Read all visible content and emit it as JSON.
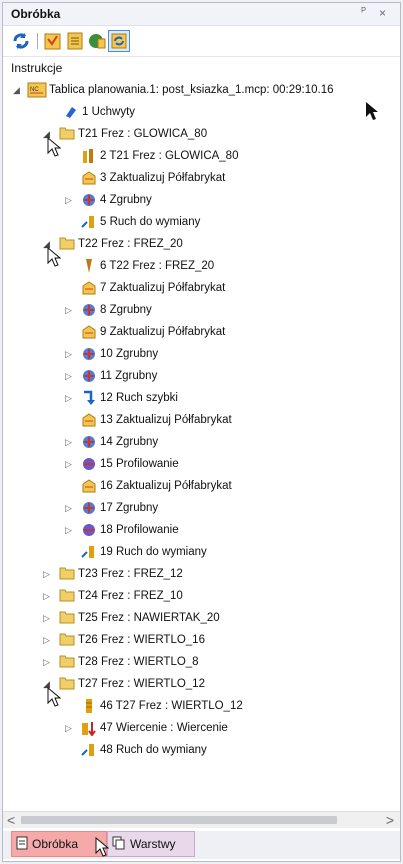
{
  "panel": {
    "title": "Obróbka",
    "pin_glyph": "ᴾ",
    "close_glyph": "×"
  },
  "toolbar": {
    "icons": [
      "refresh-icon",
      "operations-icon",
      "document-icon",
      "globe-tool-icon",
      "layers-refresh-icon"
    ]
  },
  "section_header": "Instrukcje",
  "tree": {
    "root": "Tablica planowania.1: post_ksiazka_1.mcp: 00:29:10.16",
    "items": [
      {
        "label": "1 Uchwyty"
      },
      {
        "label": "T21 Frez : GLOWICA_80"
      },
      {
        "label": "2 T21 Frez : GLOWICA_80"
      },
      {
        "label": "3 Zaktualizuj Półfabrykat"
      },
      {
        "label": "4 Zgrubny"
      },
      {
        "label": "5 Ruch do wymiany"
      },
      {
        "label": "T22 Frez : FREZ_20"
      },
      {
        "label": "6 T22 Frez : FREZ_20"
      },
      {
        "label": "7 Zaktualizuj Półfabrykat"
      },
      {
        "label": "8 Zgrubny"
      },
      {
        "label": "9 Zaktualizuj Półfabrykat"
      },
      {
        "label": "10 Zgrubny"
      },
      {
        "label": "11 Zgrubny"
      },
      {
        "label": "12 Ruch szybki"
      },
      {
        "label": "13 Zaktualizuj Półfabrykat"
      },
      {
        "label": "14 Zgrubny"
      },
      {
        "label": "15 Profilowanie"
      },
      {
        "label": "16 Zaktualizuj Półfabrykat"
      },
      {
        "label": "17 Zgrubny"
      },
      {
        "label": "18 Profilowanie"
      },
      {
        "label": "19 Ruch do wymiany"
      },
      {
        "label": "T23 Frez : FREZ_12"
      },
      {
        "label": "T24 Frez : FREZ_10"
      },
      {
        "label": "T25 Frez : NAWIERTAK_20"
      },
      {
        "label": "T26 Frez : WIERTLO_16"
      },
      {
        "label": "T28 Frez : WIERTLO_8"
      },
      {
        "label": "T27 Frez : WIERTLO_12"
      },
      {
        "label": "46 T27 Frez : WIERTLO_12"
      },
      {
        "label": "47 Wiercenie : Wiercenie"
      },
      {
        "label": "48 Ruch do wymiany"
      }
    ]
  },
  "scrollbar": {
    "left": "<",
    "right": ">"
  },
  "tabs": [
    {
      "label": "Obróbka",
      "active": true
    },
    {
      "label": "Warstwy",
      "active": false
    }
  ],
  "colors": {
    "active_tab": "#f6a9a9",
    "inactive_tab": "#e9d7ea",
    "folder": "#e8c25a"
  }
}
